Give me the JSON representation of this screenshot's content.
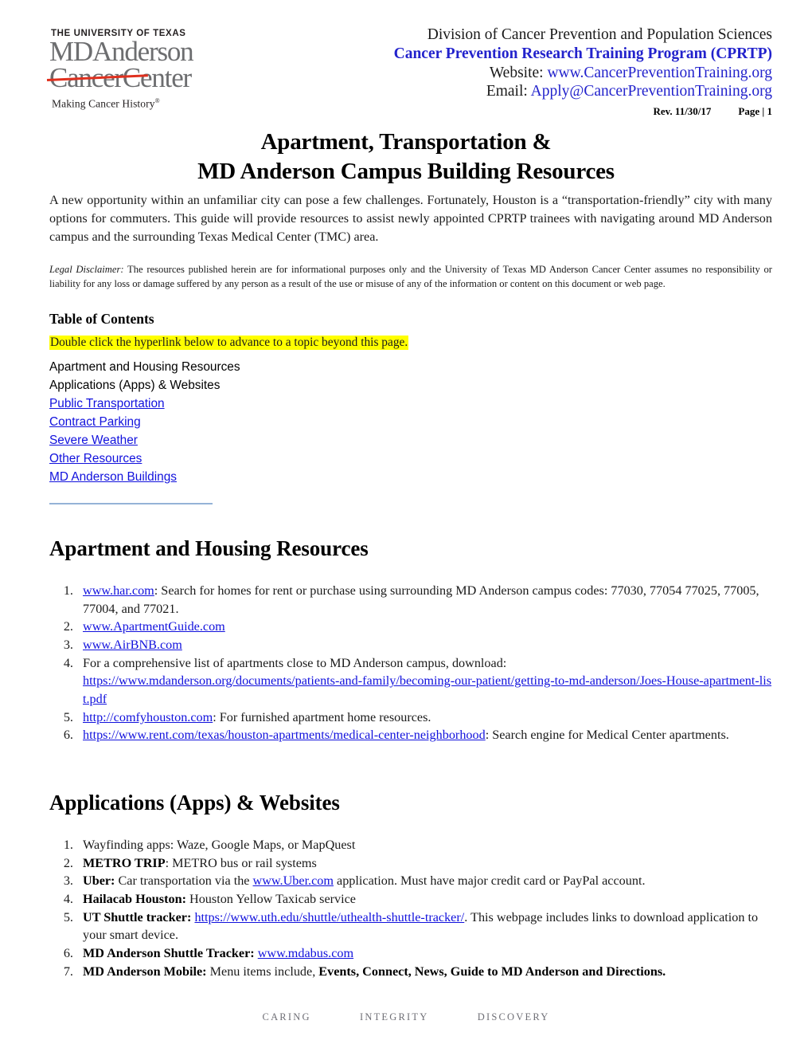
{
  "logo": {
    "tagline": "THE UNIVERSITY OF TEXAS",
    "line1": "MDAnderson",
    "line2_struck": "Cancer",
    "line2_rest": "Center",
    "slogan": "Making Cancer History",
    "slogan_mark": "®",
    "strike_color": "#e0301e",
    "wordmark_color": "#6d6e70"
  },
  "header": {
    "division": "Division of Cancer Prevention and Population Sciences",
    "program": "Cancer Prevention Research Training Program (CPRTP)",
    "website_label": "Website: ",
    "website_url": "www.CancerPreventionTraining.org",
    "email_label": "Email: ",
    "email_url": "Apply@CancerPreventionTraining.org",
    "revision": "Rev. 11/30/17",
    "page": "Page | 1",
    "accent_blue": "#2222cc"
  },
  "title": {
    "line1": "Apartment, Transportation &",
    "line2": "MD Anderson Campus Building Resources"
  },
  "intro": {
    "text": "A new opportunity within an unfamiliar city can pose a few challenges.  Fortunately, Houston is a “transportation-friendly” city with many options for commuters.  This guide will provide resources to assist newly appointed CPRTP trainees with navigating around MD Anderson campus and the surrounding Texas Medical Center (TMC) area."
  },
  "disclaimer": {
    "label": "Legal Disclaimer:",
    "text": "  The resources published herein are for informational purposes only and the University of Texas MD Anderson Cancer Center assumes no responsibility or liability for any loss or damage suffered by any person as a result of the use or misuse of any of the information or content on this document or web page."
  },
  "toc": {
    "heading": "Table of Contents",
    "note": "Double click the hyperlink below to advance to a topic beyond this page.",
    "note_highlight_color": "#ffff00",
    "items": [
      {
        "label": "Apartment and Housing Resources",
        "is_link": false
      },
      {
        "label": "Applications (Apps) & Websites",
        "is_link": false
      },
      {
        "label": "Public Transportation",
        "is_link": true
      },
      {
        "label": "Contract Parking",
        "is_link": true
      },
      {
        "label": "Severe Weather",
        "is_link": true
      },
      {
        "label": "Other Resources",
        "is_link": true
      },
      {
        "label": "MD Anderson Buildings",
        "is_link": true
      }
    ],
    "link_color": "#1111dd",
    "rule_color": "#95b3d7"
  },
  "section_housing": {
    "heading": "Apartment and Housing Resources",
    "items": [
      {
        "link": "www.har.com",
        "text": ": Search for homes for rent or purchase using surrounding MD Anderson campus codes: 77030, 77054 77025, 77005, 77004, and 77021."
      },
      {
        "link": "www.ApartmentGuide.com",
        "text": ""
      },
      {
        "link": "www.AirBNB.com",
        "text": ""
      },
      {
        "pretext": "For a comprehensive list of apartments close to MD Anderson campus, download:",
        "link": "https://www.mdanderson.org/documents/patients-and-family/becoming-our-patient/getting-to-md-anderson/Joes-House-apartment-list.pdf",
        "text": ""
      },
      {
        "link": "http://comfyhouston.com",
        "text": ": For furnished apartment home resources."
      },
      {
        "link": "https://www.rent.com/texas/houston-apartments/medical-center-neighborhood",
        "text": ": Search engine for Medical Center apartments."
      }
    ]
  },
  "section_apps": {
    "heading": "Applications (Apps) & Websites",
    "items": [
      {
        "bold": "",
        "text": "Wayfinding apps: Waze, Google Maps, or MapQuest",
        "link": "",
        "after": ""
      },
      {
        "bold": "METRO TRIP",
        "text": ":  METRO bus or rail systems",
        "link": "",
        "after": ""
      },
      {
        "bold": "Uber:",
        "text": " Car transportation via the ",
        "link": "www.Uber.com",
        "after": " application. Must have major credit card or PayPal account."
      },
      {
        "bold": "Hailacab Houston:",
        "text": "  Houston Yellow Taxicab service",
        "link": "",
        "after": ""
      },
      {
        "bold": "UT Shuttle tracker:",
        "text": "  ",
        "link": "https://www.uth.edu/shuttle/uthealth-shuttle-tracker/",
        "after": ". This webpage includes links to download application to your smart device."
      },
      {
        "bold": "MD Anderson Shuttle Tracker:",
        "text": "  ",
        "link": "www.mdabus.com",
        "after": ""
      },
      {
        "bold": "MD Anderson Mobile:",
        "text": "  Menu items include, ",
        "link": "",
        "after": "",
        "bold_tail": "Events, Connect, News, Guide to MD Anderson and Directions."
      }
    ]
  },
  "footer": {
    "values": [
      "CARING",
      "INTEGRITY",
      "DISCOVERY"
    ]
  }
}
